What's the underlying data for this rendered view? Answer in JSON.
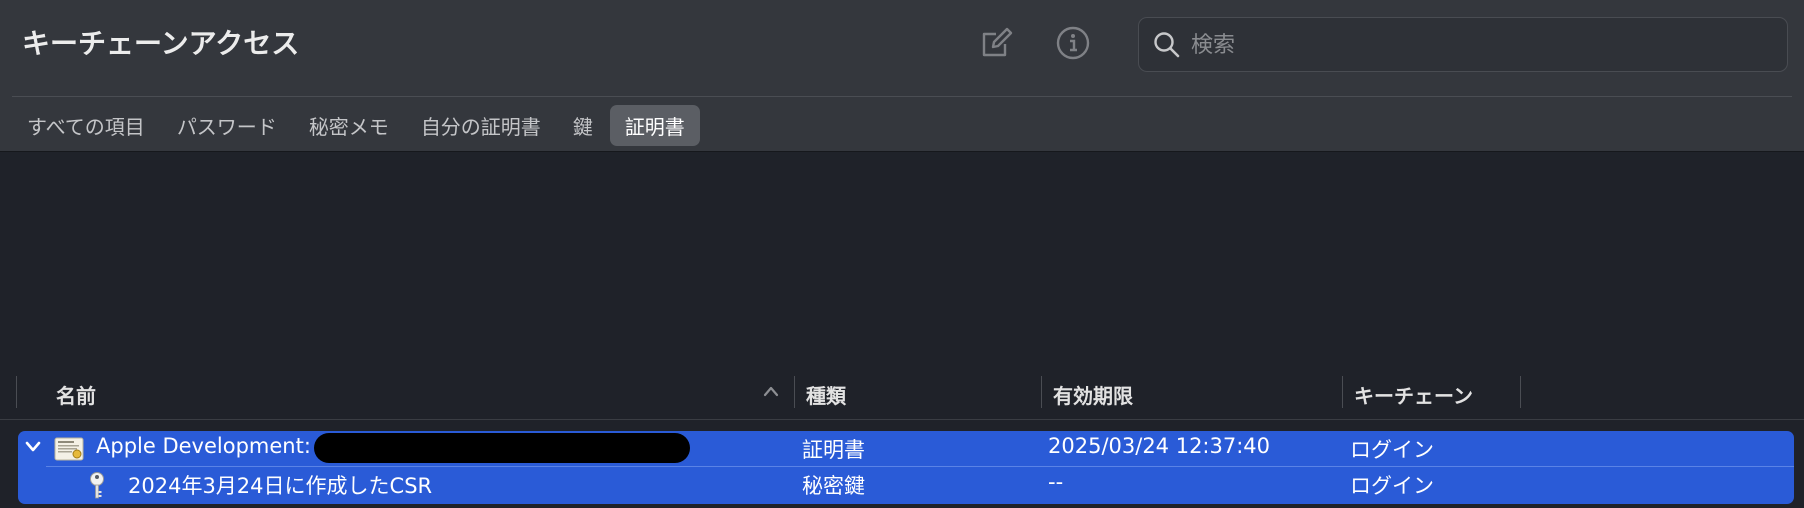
{
  "window": {
    "title": "キーチェーンアクセス"
  },
  "toolbar": {
    "icons": [
      "compose-icon",
      "info-icon"
    ]
  },
  "search": {
    "placeholder": "検索",
    "value": ""
  },
  "tabs": [
    {
      "label": "すべての項目",
      "active": false
    },
    {
      "label": "パスワード",
      "active": false
    },
    {
      "label": "秘密メモ",
      "active": false
    },
    {
      "label": "自分の証明書",
      "active": false
    },
    {
      "label": "鍵",
      "active": false
    },
    {
      "label": "証明書",
      "active": true
    }
  ],
  "list": {
    "columns": {
      "name": "名前",
      "kind": "種類",
      "expires": "有効期限",
      "keychain": "キーチェーン"
    },
    "sort": {
      "column": "name",
      "direction": "ascending"
    },
    "rows": [
      {
        "name": "Apple Development: ",
        "kind": "証明書",
        "expires": "2025/03/24 12:37:40",
        "keychain": "ログイン",
        "icon": "certificate-icon",
        "expanded": true,
        "redacted": true
      },
      {
        "name": "2024年3月24日に作成したCSR",
        "kind": "秘密鍵",
        "expires": "--",
        "keychain": "ログイン",
        "icon": "key-icon",
        "child": true
      }
    ]
  },
  "colors": {
    "selection": "#2a5bd7",
    "toolbar_bg": "#34373d",
    "content_bg": "#1f2229"
  }
}
